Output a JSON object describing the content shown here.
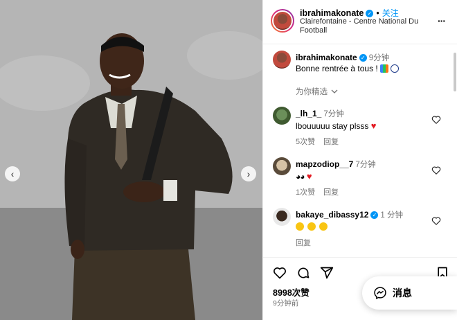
{
  "post": {
    "username": "ibrahimakonate",
    "follow_label": "关注",
    "separator": "•",
    "location": "Clairefontaine - Centre National Du Football"
  },
  "caption": {
    "username": "ibrahimakonate",
    "time": "9分钟",
    "text": "Bonne rentrée à tous !"
  },
  "recommend_label": "为你精选",
  "comments": [
    {
      "username": "_lh_1_",
      "time": "7分钟",
      "text": "lbouuuuu stay plsss",
      "likes": "5次赞",
      "reply": "回复"
    },
    {
      "username": "mapzodiop__7",
      "time": "7分钟",
      "likes": "1次赞",
      "reply": "回复"
    },
    {
      "username": "bakaye_dibassy12",
      "time": "1 分钟",
      "reply": "回复"
    }
  ],
  "actions": {
    "likes": "8998次赞",
    "time_ago": "9分钟前"
  },
  "messages": {
    "label": "消息"
  },
  "colors": {
    "accent": "#0095f6",
    "heart": "#e31b23",
    "muted": "#737373"
  },
  "icons": [
    "chevron-left-icon",
    "chevron-right-icon",
    "more-icon",
    "verified-icon",
    "heart-icon",
    "comment-icon",
    "share-icon",
    "bookmark-icon",
    "messenger-icon",
    "chevron-down-icon"
  ]
}
